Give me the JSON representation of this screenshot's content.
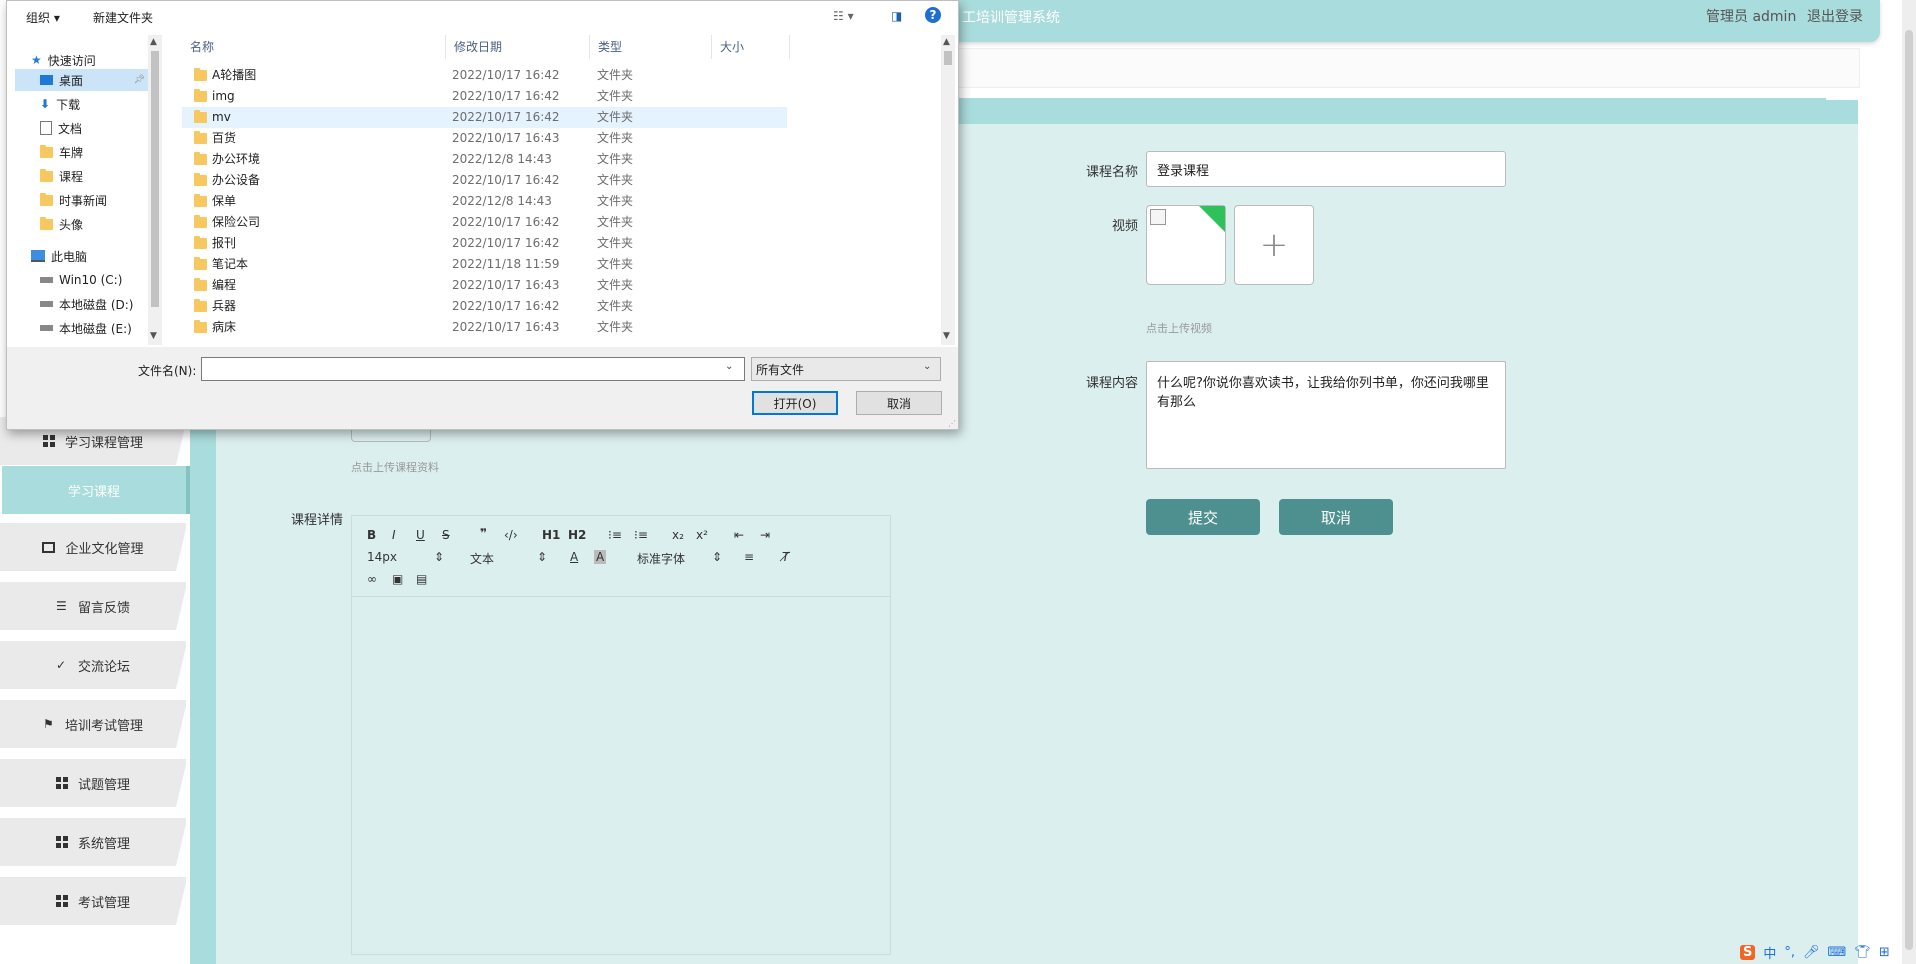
{
  "header": {
    "app_title": "工培训管理系统",
    "user_label": "管理员 admin",
    "logout_label": "退出登录"
  },
  "sidebar": {
    "items": [
      {
        "label": "学习课程管理",
        "icon": "grid-icon"
      },
      {
        "label": "学习课程",
        "active": true
      },
      {
        "label": "企业文化管理",
        "icon": "monitor-icon"
      },
      {
        "label": "留言反馈",
        "icon": "list-icon"
      },
      {
        "label": "交流论坛",
        "icon": "clipboard-icon"
      },
      {
        "label": "培训考试管理",
        "icon": "flag-icon"
      },
      {
        "label": "试题管理",
        "icon": "grid-icon"
      },
      {
        "label": "系统管理",
        "icon": "grid-icon"
      },
      {
        "label": "考试管理",
        "icon": "grid-icon"
      }
    ]
  },
  "form": {
    "course_name_label": "课程名称",
    "course_name_value": "登录课程",
    "video_label": "视频",
    "video_hint": "点击上传视频",
    "material_hint": "点击上传课程资料",
    "content_label": "课程内容",
    "content_value": "什么呢?你说你喜欢读书，让我给你列书单，你还问我哪里有那么",
    "detail_label": "课程详情",
    "submit_label": "提交",
    "cancel_label": "取消"
  },
  "editor": {
    "font_size": "14px",
    "paragraph": "文本",
    "font_family": "标准字体",
    "h1": "H1",
    "h2": "H2"
  },
  "dialog": {
    "toolbar": {
      "organize": "组织 ▾",
      "new_folder": "新建文件夹"
    },
    "nav": [
      {
        "label": "快速访问",
        "icon": "star-icon"
      },
      {
        "label": "桌面",
        "icon": "desktop-icon",
        "selected": true,
        "pinned": true
      },
      {
        "label": "下载",
        "icon": "download-icon",
        "pinned": true
      },
      {
        "label": "文档",
        "icon": "document-icon",
        "pinned": true
      },
      {
        "label": "车牌",
        "icon": "folder-icon"
      },
      {
        "label": "课程",
        "icon": "folder-icon"
      },
      {
        "label": "时事新闻",
        "icon": "folder-icon"
      },
      {
        "label": "头像",
        "icon": "folder-icon"
      },
      {
        "label": "此电脑",
        "icon": "computer-icon"
      },
      {
        "label": "Win10 (C:)",
        "icon": "drive-icon"
      },
      {
        "label": "本地磁盘 (D:)",
        "icon": "drive-icon"
      },
      {
        "label": "本地磁盘 (E:)",
        "icon": "drive-icon"
      }
    ],
    "columns": [
      "名称",
      "修改日期",
      "类型",
      "大小"
    ],
    "rows": [
      {
        "name": "A轮播图",
        "date": "2022/10/17 16:42",
        "type": "文件夹"
      },
      {
        "name": "img",
        "date": "2022/10/17 16:42",
        "type": "文件夹"
      },
      {
        "name": "mv",
        "date": "2022/10/17 16:42",
        "type": "文件夹"
      },
      {
        "name": "百货",
        "date": "2022/10/17 16:43",
        "type": "文件夹"
      },
      {
        "name": "办公环境",
        "date": "2022/12/8 14:43",
        "type": "文件夹"
      },
      {
        "name": "办公设备",
        "date": "2022/10/17 16:42",
        "type": "文件夹"
      },
      {
        "name": "保单",
        "date": "2022/12/8 14:43",
        "type": "文件夹"
      },
      {
        "name": "保险公司",
        "date": "2022/10/17 16:42",
        "type": "文件夹"
      },
      {
        "name": "报刊",
        "date": "2022/10/17 16:42",
        "type": "文件夹"
      },
      {
        "name": "笔记本",
        "date": "2022/11/18 11:59",
        "type": "文件夹"
      },
      {
        "name": "编程",
        "date": "2022/10/17 16:43",
        "type": "文件夹"
      },
      {
        "name": "兵器",
        "date": "2022/10/17 16:42",
        "type": "文件夹"
      },
      {
        "name": "病床",
        "date": "2022/10/17 16:43",
        "type": "文件夹"
      }
    ],
    "filename_label": "文件名(N):",
    "filename_value": "",
    "filter_value": "所有文件",
    "open_label": "打开(O)",
    "cancel_label": "取消"
  },
  "tray": {
    "ime": "中",
    "punct": "°,"
  }
}
